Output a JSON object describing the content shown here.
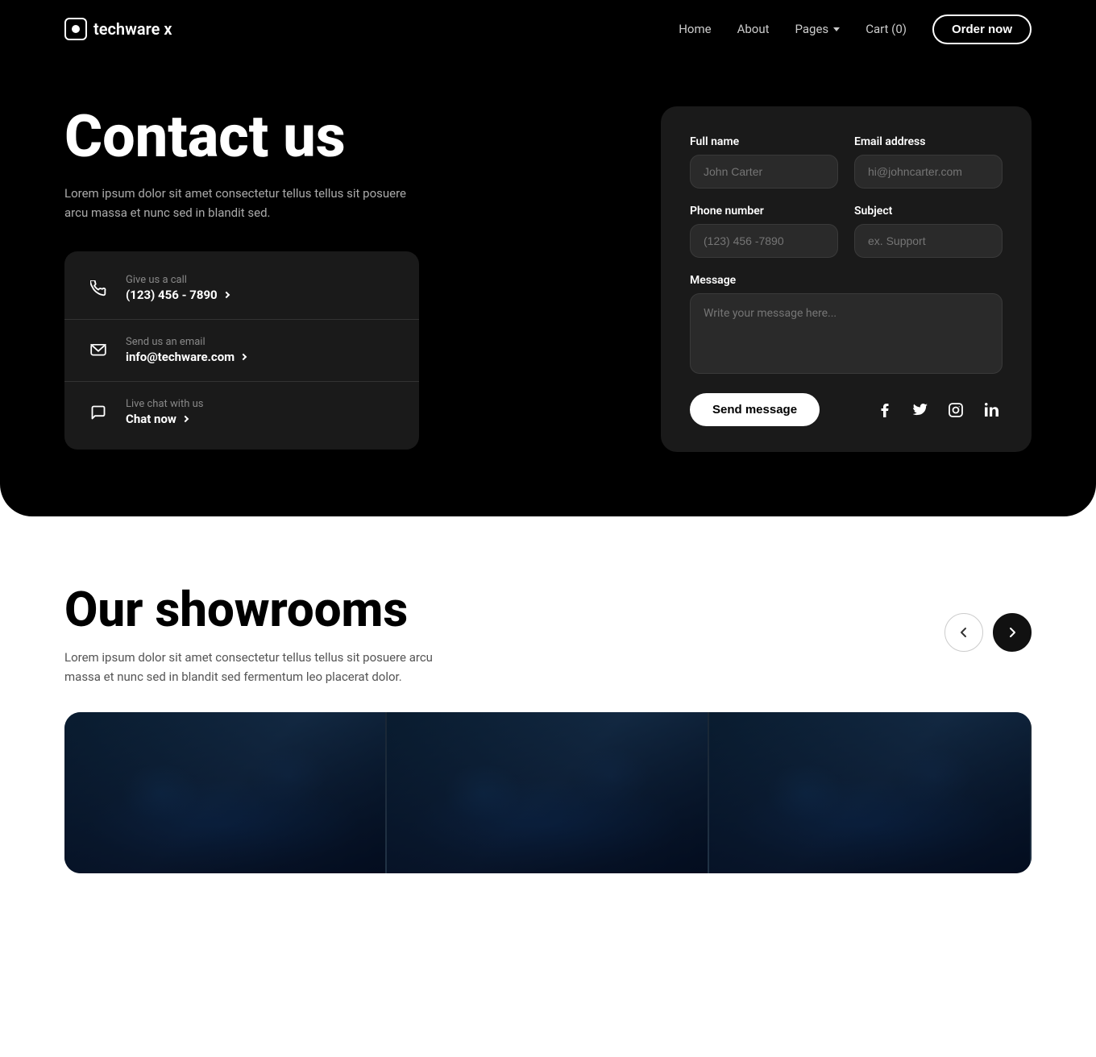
{
  "brand": {
    "name": "techware x"
  },
  "nav": {
    "home": "Home",
    "about": "About",
    "pages": "Pages",
    "cart": "Cart (0)",
    "order_now": "Order now"
  },
  "hero": {
    "title": "Contact us",
    "subtitle": "Lorem ipsum dolor sit amet consectetur tellus tellus sit posuere arcu massa et nunc sed in blandit sed.",
    "contacts": [
      {
        "label": "Give us a call",
        "value": "(123) 456 - 7890",
        "icon": "phone"
      },
      {
        "label": "Send us an email",
        "value": "info@techware.com",
        "icon": "email"
      },
      {
        "label": "Live chat with us",
        "value": "Chat now",
        "icon": "chat"
      }
    ]
  },
  "form": {
    "full_name_label": "Full name",
    "full_name_placeholder": "John Carter",
    "email_label": "Email address",
    "email_placeholder": "hi@johncarter.com",
    "phone_label": "Phone number",
    "phone_placeholder": "(123) 456 -7890",
    "subject_label": "Subject",
    "subject_placeholder": "ex. Support",
    "message_label": "Message",
    "message_placeholder": "Write your message here...",
    "send_button": "Send message"
  },
  "showrooms": {
    "title": "Our showrooms",
    "subtitle": "Lorem ipsum dolor sit amet consectetur tellus tellus sit posuere arcu massa et nunc sed in blandit sed fermentum leo placerat dolor."
  },
  "social": {
    "facebook": "f",
    "twitter": "t",
    "instagram": "◻",
    "linkedin": "in"
  }
}
